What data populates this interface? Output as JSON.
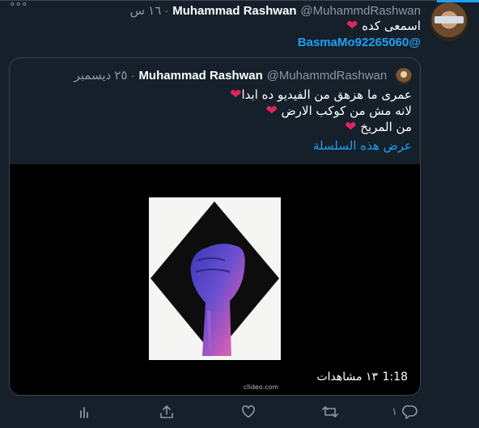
{
  "tweet": {
    "author_name": "Muhammad Rashwan",
    "handle": "@MuhammdRashwan",
    "time": "· ١٦ س",
    "text_line1": "اسمعى كده",
    "mention": "@BasmaMo92265060",
    "more_icon": "ellipsis-icon"
  },
  "quote": {
    "author_name": "Muhammad Rashwan",
    "handle": "@MuhammdRashwan",
    "date": "· ٢٥ ديسمبر",
    "line1": "عمرى ما هزهق من الفيديو ده ابدا",
    "line2": "لانه مش من كوكب الارض",
    "line3": "من المريخ",
    "show_thread": "عرض هذه السلسلة",
    "video": {
      "views": "١٣ مشاهدات",
      "duration": "1:18",
      "watermark": "clideo.com"
    }
  },
  "actions": {
    "reply_count": "١",
    "icons": [
      "reply-icon",
      "retweet-icon",
      "like-icon",
      "share-icon",
      "analytics-icon"
    ]
  },
  "colors": {
    "background": "#15202b",
    "accent": "#1da1f2",
    "muted": "#8899a6",
    "heart": "#e0245e",
    "border": "#38444d"
  }
}
